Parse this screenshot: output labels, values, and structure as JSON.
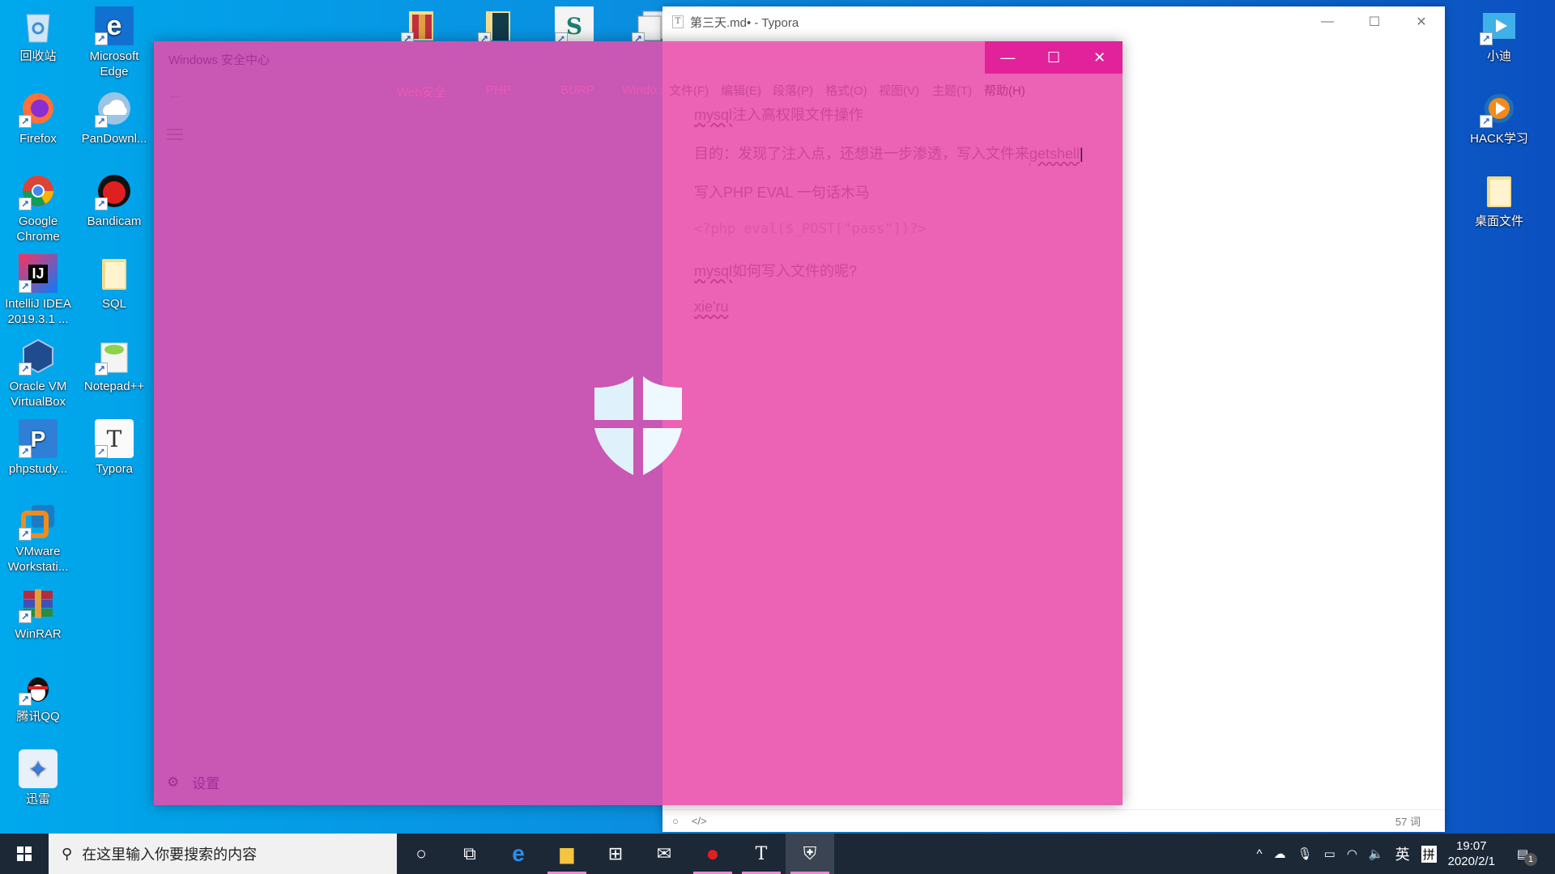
{
  "desktop": {
    "left_column_1": [
      {
        "label": "回收站",
        "icon": "recycle-bin-icon"
      },
      {
        "label": "Firefox",
        "icon": "firefox-icon"
      },
      {
        "label": "Google Chrome",
        "icon": "chrome-icon"
      },
      {
        "label": "IntelliJ IDEA 2019.3.1 ...",
        "icon": "intellij-icon"
      },
      {
        "label": "Oracle VM VirtualBox",
        "icon": "virtualbox-icon"
      },
      {
        "label": "phpstudy...",
        "icon": "phpstudy-icon"
      },
      {
        "label": "VMware Workstati...",
        "icon": "vmware-icon"
      },
      {
        "label": "WinRAR",
        "icon": "winrar-icon"
      },
      {
        "label": "腾讯QQ",
        "icon": "qq-icon"
      },
      {
        "label": "迅雷",
        "icon": "xunlei-icon"
      }
    ],
    "left_column_2": [
      {
        "label": "Microsoft Edge",
        "icon": "edge-icon"
      },
      {
        "label": "PanDownl...",
        "icon": "pandownload-icon"
      },
      {
        "label": "Bandicam",
        "icon": "bandicam-icon"
      },
      {
        "label": "SQL",
        "icon": "folder-icon"
      },
      {
        "label": "Notepad++",
        "icon": "notepadpp-icon"
      },
      {
        "label": "Typora",
        "icon": "typora-icon"
      }
    ],
    "top_row": [
      {
        "label": "Web安全",
        "icon": "winrar-folder-icon"
      },
      {
        "label": "PHP",
        "icon": "book-folder-icon"
      },
      {
        "label": "BURP",
        "icon": "script-icon"
      },
      {
        "label": "Windo...",
        "icon": "windows-folder-icon"
      }
    ],
    "right_column": [
      {
        "label": "小迪",
        "icon": "video-icon"
      },
      {
        "label": "HACK学习",
        "icon": "media-player-icon"
      },
      {
        "label": "桌面文件",
        "icon": "folder-icon"
      }
    ]
  },
  "security_window": {
    "title": "Windows 安全中心",
    "back_glyph": "←",
    "settings_label": "设置",
    "controls": {
      "minimize": "—",
      "maximize": "☐",
      "close": "✕"
    },
    "colors": {
      "left": "#c957b4",
      "right": "#ec62b5",
      "titlebar_active": "#e2229a"
    }
  },
  "typora": {
    "title": "第三天.md• - Typora",
    "menu": [
      "文件(F)",
      "编辑(E)",
      "段落(P)",
      "格式(O)",
      "视图(V)",
      "主题(T)",
      "帮助(H)"
    ],
    "lines": [
      {
        "pre": "mysql",
        "rest": "注入高权限文件操作"
      },
      {
        "pre": "",
        "rest": "目的：发现了注入点，还想进一步渗透，写入文件来",
        "post": "getshell"
      },
      {
        "pre": "",
        "rest": "写入PHP EVAL 一句话木马"
      },
      {
        "code": "<?php eval($_POST[\"pass\"])?>"
      },
      {
        "pre": "mysql",
        "rest": "如何写入文件的呢?"
      },
      {
        "pre": "xie'ru",
        "rest": ""
      }
    ],
    "status": {
      "word_count": "57 词",
      "source_toggle": "</>",
      "sidebar_toggle": "○"
    }
  },
  "taskbar": {
    "search_placeholder": "在这里输入你要搜索的内容",
    "apps": [
      {
        "name": "cortana",
        "glyph": "○"
      },
      {
        "name": "task-view",
        "glyph": "⧉"
      },
      {
        "name": "edge",
        "glyph": "e"
      },
      {
        "name": "file-explorer",
        "glyph": "▆"
      },
      {
        "name": "store",
        "glyph": "⊞"
      },
      {
        "name": "mail",
        "glyph": "✉"
      },
      {
        "name": "bandicam",
        "glyph": "●"
      },
      {
        "name": "typora",
        "glyph": "T"
      },
      {
        "name": "windows-security",
        "glyph": "⛨"
      }
    ],
    "tray": {
      "ime_lang": "英",
      "ime_mode": "拼",
      "time": "19:07",
      "date": "2020/2/1",
      "notification_count": "1"
    }
  }
}
